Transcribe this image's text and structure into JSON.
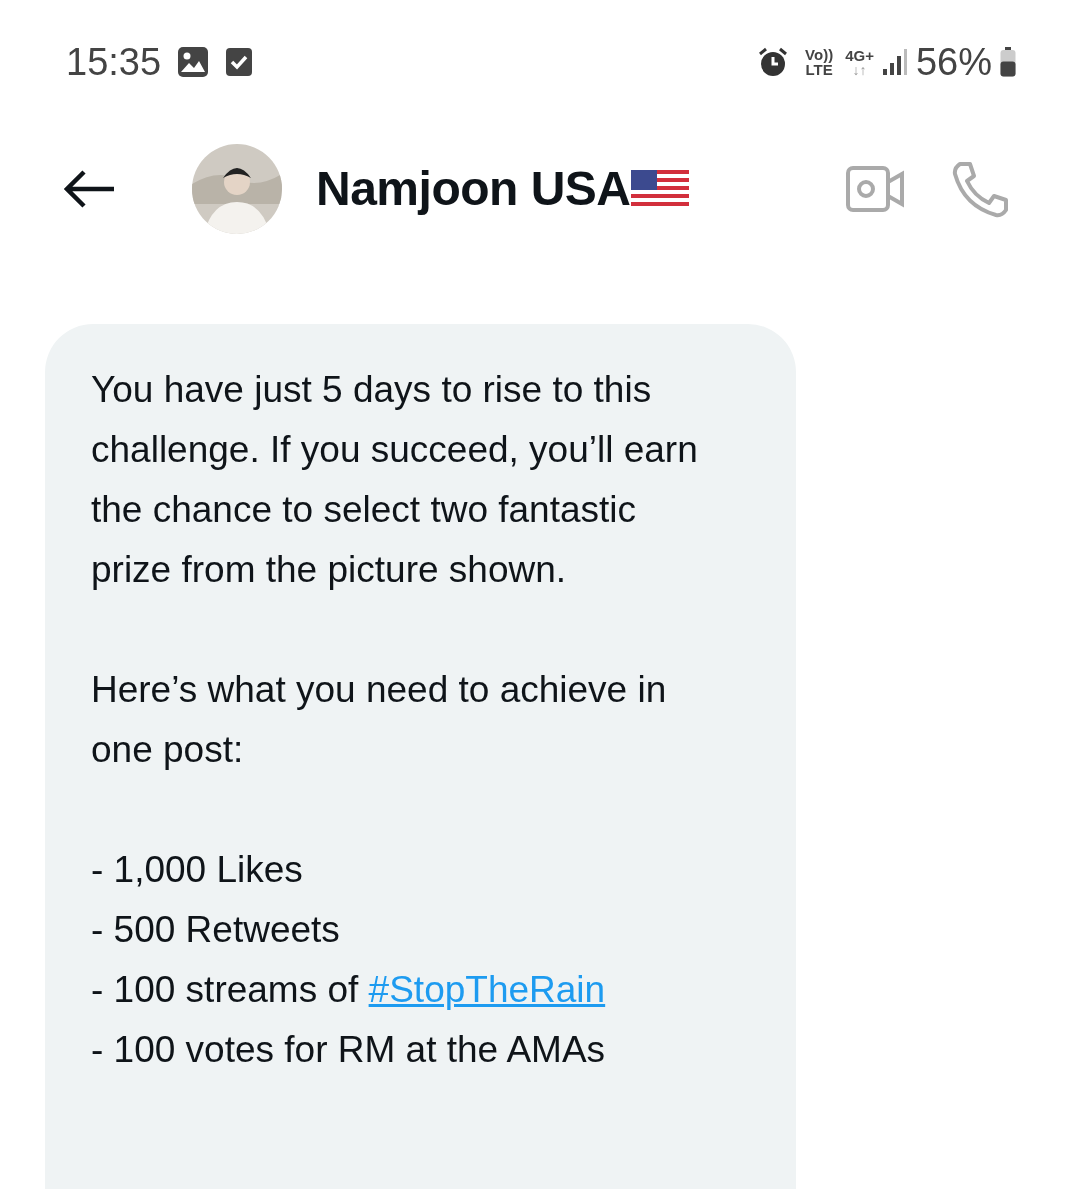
{
  "status_bar": {
    "time": "15:35",
    "volte": "Vo))",
    "lte": "LTE",
    "network": "4G+",
    "network_arrows": "↓↑",
    "battery": "56%"
  },
  "header": {
    "contact_name": "Namjoon USA"
  },
  "message": {
    "paragraphs": [
      {
        "lines": [
          {
            "text": "You have just 5 days to rise to this challenge. If you succeed, you’ll earn the chance to select two fantastic prize from the picture shown."
          }
        ]
      },
      {
        "lines": [
          {
            "text": "Here’s what you need to achieve in one post:"
          }
        ]
      },
      {
        "lines": [
          {
            "text": "- 1,000 Likes"
          },
          {
            "text": "- 500 Retweets"
          },
          {
            "text": "- 100 streams of ",
            "link": "#StopTheRain"
          },
          {
            "text": "- 100 votes for RM at the AMAs"
          }
        ]
      }
    ]
  }
}
